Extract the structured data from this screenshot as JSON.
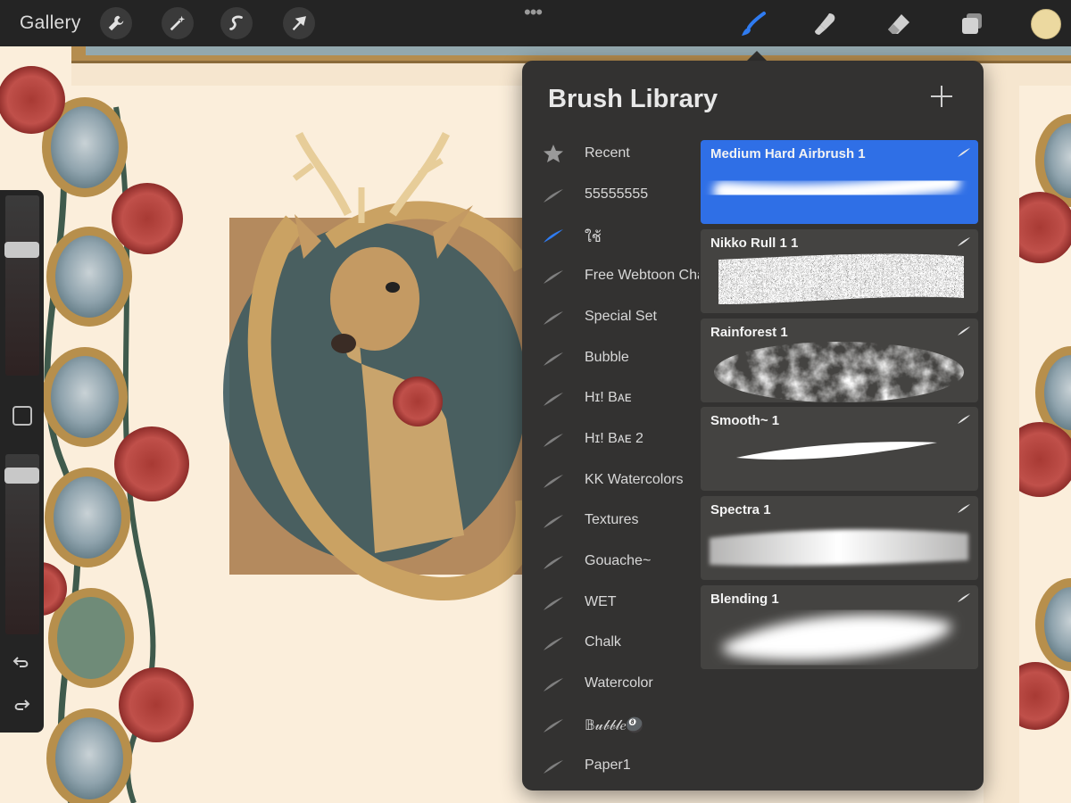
{
  "topbar": {
    "gallery_label": "Gallery",
    "tools_left": [
      "wrench-icon",
      "magic-wand-icon",
      "selection-icon",
      "transform-arrow-icon"
    ],
    "tools_right": [
      "brush-icon",
      "smudge-icon",
      "eraser-icon",
      "layers-icon"
    ],
    "active_tool": "brush-icon",
    "current_color": "#ecd9a0"
  },
  "sidebar": {
    "size_value": 0.72,
    "opacity_value": 0.92,
    "icons": [
      "modifier-square-icon",
      "undo-icon",
      "redo-icon"
    ]
  },
  "brush_library": {
    "title": "Brush Library",
    "add_icon": "plus-icon",
    "sets": [
      {
        "label": "Recent",
        "icon": "star-icon"
      },
      {
        "label": "55555555",
        "icon": "brush-stroke-icon"
      },
      {
        "label": "ใช้",
        "icon": "brush-stroke-icon",
        "selected": true
      },
      {
        "label": "Free Webtoon Cha",
        "icon": "brush-stroke-icon"
      },
      {
        "label": "Special Set",
        "icon": "brush-stroke-icon"
      },
      {
        "label": "Bubble",
        "icon": "brush-stroke-icon"
      },
      {
        "label": "Hɪ! Bᴀᴇ",
        "icon": "brush-stroke-icon"
      },
      {
        "label": "Hɪ! Bᴀᴇ 2",
        "icon": "brush-stroke-icon"
      },
      {
        "label": "KK Watercolors",
        "icon": "brush-stroke-icon"
      },
      {
        "label": "Textures",
        "icon": "brush-stroke-icon"
      },
      {
        "label": "Gouache~",
        "icon": "brush-stroke-icon"
      },
      {
        "label": "WET",
        "icon": "brush-stroke-icon"
      },
      {
        "label": "Chalk",
        "icon": "brush-stroke-icon"
      },
      {
        "label": "Watercolor",
        "icon": "brush-stroke-icon"
      },
      {
        "label": "𝔹𝓊𝒷𝒷𝓁𝑒🎱",
        "icon": "brush-stroke-icon"
      },
      {
        "label": "Paper1",
        "icon": "brush-stroke-icon"
      }
    ],
    "brushes": [
      {
        "name": "Medium Hard Airbrush 1",
        "selected": true
      },
      {
        "name": "Nikko Rull 1 1"
      },
      {
        "name": "Rainforest 1"
      },
      {
        "name": "Smooth~ 1"
      },
      {
        "name": "Spectra 1"
      },
      {
        "name": "Blending  1"
      }
    ],
    "accent_color": "#2f6fe6"
  }
}
